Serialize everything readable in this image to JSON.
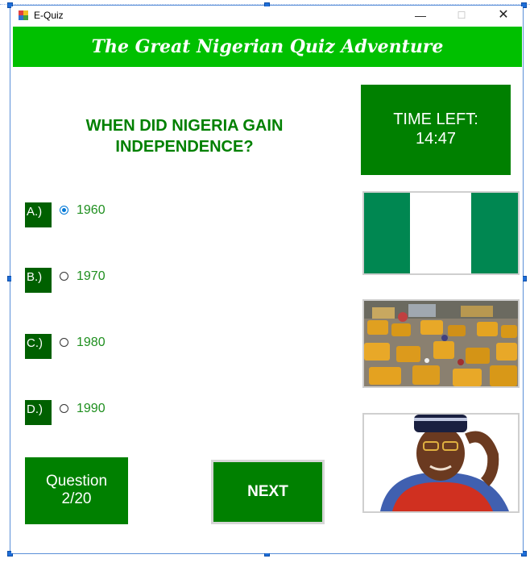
{
  "window": {
    "title": "E-Quiz"
  },
  "banner": {
    "title": "The Great Nigerian Quiz Adventure"
  },
  "question": {
    "text": "WHEN DID NIGERIA GAIN INDEPENDENCE?"
  },
  "timer": {
    "label": "TIME LEFT:",
    "value": "14:47"
  },
  "options": [
    {
      "letter": "A.)",
      "value": "1960",
      "selected": true
    },
    {
      "letter": "B.)",
      "value": "1970",
      "selected": false
    },
    {
      "letter": "C.)",
      "value": "1980",
      "selected": false
    },
    {
      "letter": "D.)",
      "value": "1990",
      "selected": false
    }
  ],
  "progress": {
    "label": "Question",
    "value": "2/20"
  },
  "next_button": {
    "label": "NEXT"
  },
  "images": [
    "nigeria-flag",
    "lagos-market-traffic",
    "man-in-traditional-cap"
  ],
  "colors": {
    "banner": "#00c000",
    "panel": "#008000",
    "option_label": "#006000",
    "option_text": "#1f8f1f",
    "radio_selected": "#0078d7"
  }
}
